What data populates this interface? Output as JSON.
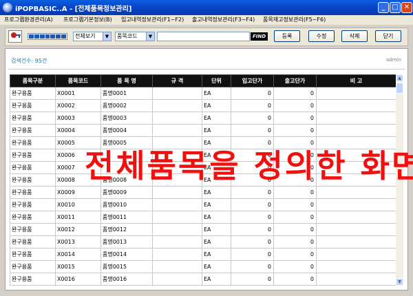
{
  "window": {
    "title": "iPOPBASIC..A - [전체품목정보관리]",
    "controls": {
      "minimize": "_",
      "maximize": "□",
      "close": "✕"
    }
  },
  "menu": [
    "프로그램환경관리(A)",
    "프로그램기본정보(B)",
    "입고내역정보관리(F1~F2)",
    "출고내역정보관리(F3~F4)",
    "품목재고정보관리(F5~F6)"
  ],
  "toolbar": {
    "icon": "user-key-icon",
    "progress_fraction": 1.0,
    "view_select": "전체보기",
    "field_select": "품목코드",
    "search_value": "",
    "find_label": "FIND",
    "buttons": {
      "register": "등록",
      "edit": "수정",
      "delete": "삭제",
      "close": "닫기"
    }
  },
  "status": {
    "count": "검색건수: 95건",
    "user": "admin"
  },
  "table": {
    "headers": [
      "품목구분",
      "품목코드",
      "품 목 명",
      "규  격",
      "단위",
      "입고단가",
      "출고단가",
      "비  고"
    ],
    "rows": [
      [
        "완구용품",
        "X0001",
        "품명0001",
        "",
        "EA",
        "0",
        "0",
        ""
      ],
      [
        "완구용품",
        "X0002",
        "품명0002",
        "",
        "EA",
        "0",
        "0",
        ""
      ],
      [
        "완구용품",
        "X0003",
        "품명0003",
        "",
        "EA",
        "0",
        "0",
        ""
      ],
      [
        "완구용품",
        "X0004",
        "품명0004",
        "",
        "EA",
        "0",
        "0",
        ""
      ],
      [
        "완구용품",
        "X0005",
        "품명0005",
        "",
        "EA",
        "0",
        "0",
        ""
      ],
      [
        "완구용품",
        "X0006",
        "",
        "",
        "EA",
        "0",
        "0",
        ""
      ],
      [
        "완구용품",
        "X0007",
        "",
        "",
        "EA",
        "0",
        "0",
        ""
      ],
      [
        "완구용품",
        "X0008",
        "품명0008",
        "",
        "EA",
        "0",
        "0",
        ""
      ],
      [
        "완구용품",
        "X0009",
        "품명0009",
        "",
        "EA",
        "0",
        "0",
        ""
      ],
      [
        "완구용품",
        "X0010",
        "품명0010",
        "",
        "EA",
        "0",
        "0",
        ""
      ],
      [
        "완구용품",
        "X0011",
        "품명0011",
        "",
        "EA",
        "0",
        "0",
        ""
      ],
      [
        "완구용품",
        "X0012",
        "품명0012",
        "",
        "EA",
        "0",
        "0",
        ""
      ],
      [
        "완구용품",
        "X0013",
        "품명0013",
        "",
        "EA",
        "0",
        "0",
        ""
      ],
      [
        "완구용품",
        "X0014",
        "품명0014",
        "",
        "EA",
        "0",
        "0",
        ""
      ],
      [
        "완구용품",
        "X0015",
        "품명0015",
        "",
        "EA",
        "0",
        "0",
        ""
      ],
      [
        "완구용품",
        "X0016",
        "품명0016",
        "",
        "EA",
        "0",
        "0",
        ""
      ]
    ]
  },
  "overlay_caption": "전체품목을 정의한 화면",
  "colors": {
    "title_bar": "#0844c8",
    "overlay": "#f01010",
    "header_bg": "#111111",
    "count_text": "#1e7ab0"
  }
}
